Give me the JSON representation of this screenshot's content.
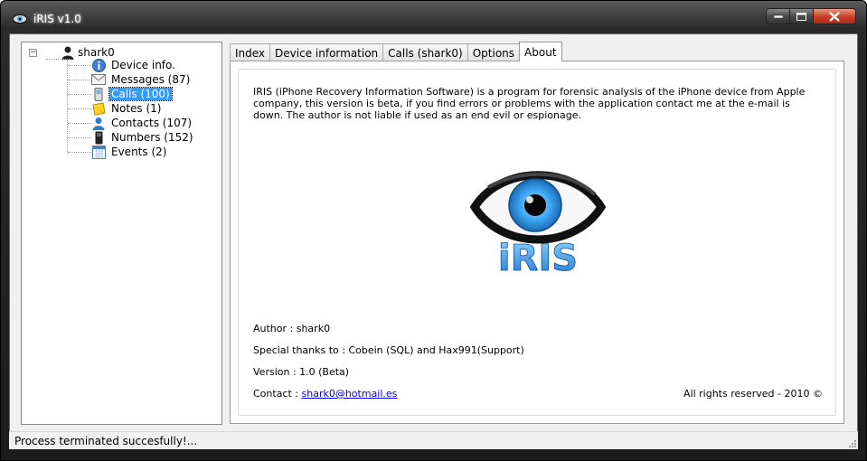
{
  "window": {
    "title": "iRIS v1.0"
  },
  "tree": {
    "root": "shark0",
    "items": [
      {
        "label": "Device info.",
        "icon": "info-icon"
      },
      {
        "label": "Messages (87)",
        "icon": "envelope-icon"
      },
      {
        "label": "Calls (100)",
        "icon": "phone-icon",
        "selected": true
      },
      {
        "label": "Notes (1)",
        "icon": "note-icon"
      },
      {
        "label": "Contacts (107)",
        "icon": "contact-icon"
      },
      {
        "label": "Numbers (152)",
        "icon": "cellphone-icon"
      },
      {
        "label": "Events (2)",
        "icon": "calendar-icon"
      }
    ]
  },
  "tabs": [
    "Index",
    "Device information",
    "Calls (shark0)",
    "Options",
    "About"
  ],
  "active_tab": "About",
  "about": {
    "description": "IRIS (iPhone Recovery Information Software) is a program for forensic analysis of the iPhone device from Apple company, this version is beta, if you find errors or problems with the application contact me at the e-mail is down. The author is not liable if used as an end evil or espionage.",
    "logo_text": "iRIS",
    "author": "Author : shark0",
    "thanks": "Special thanks to : Cobein (SQL) and Hax991(Support)",
    "version": "Version : 1.0 (Beta)",
    "contact_label": "Contact : ",
    "contact_email": "shark0@hotmail.es",
    "rights": "All rights reserved - 2010 ©"
  },
  "status": {
    "text": "Process terminated succesfully!..."
  },
  "colors": {
    "selection": "#3399ff",
    "logo_blue": "#3fa9f5",
    "link": "#0000ee"
  }
}
